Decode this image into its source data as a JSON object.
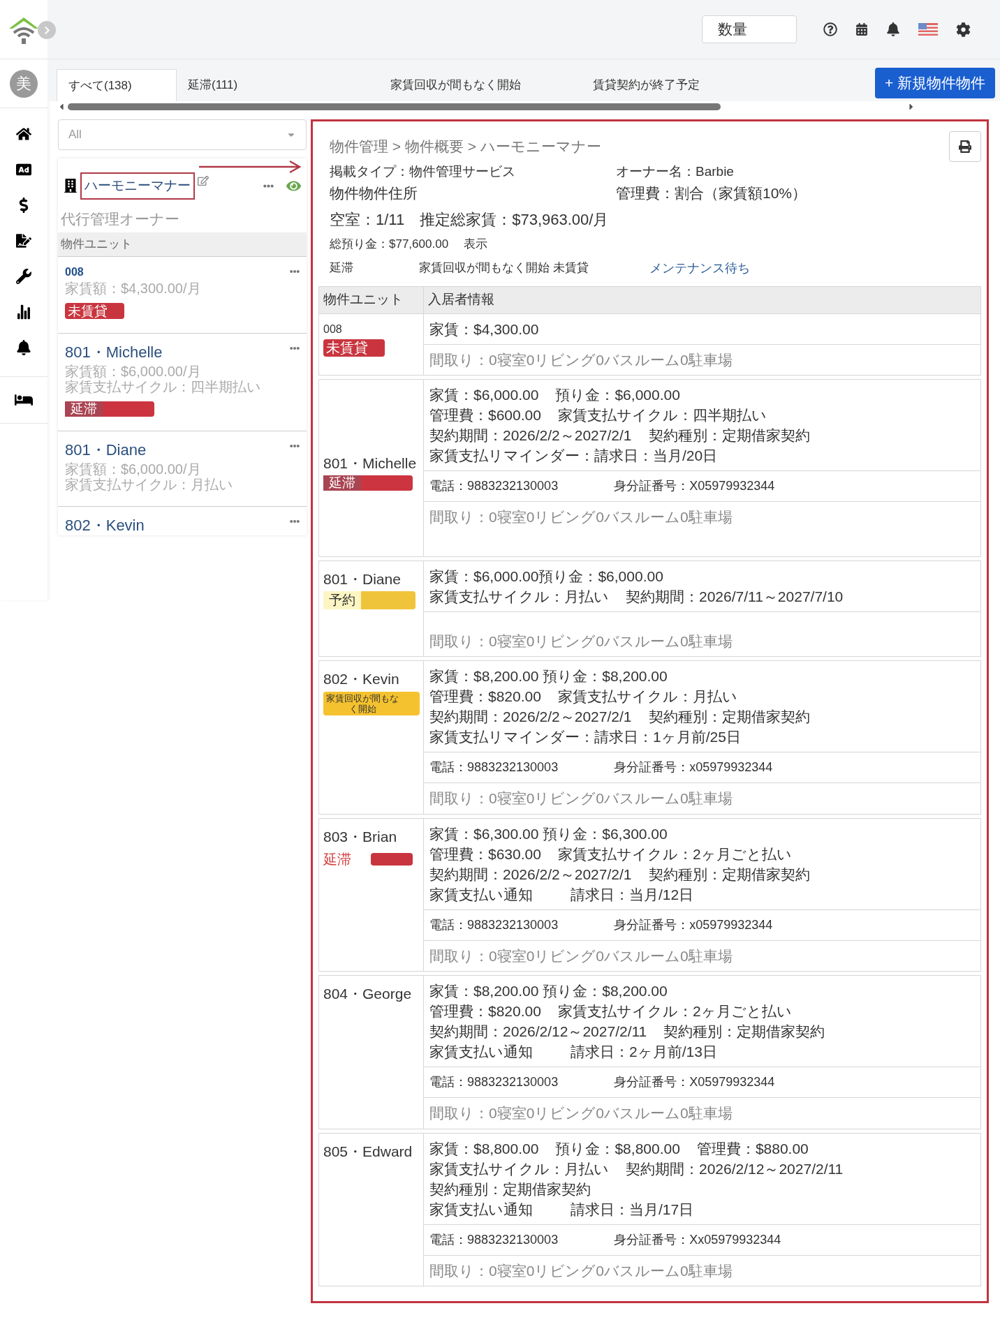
{
  "avatar": "美",
  "header": {
    "select_value": "数量"
  },
  "tabs": [
    {
      "label": "すべて(138)",
      "selected": true
    },
    {
      "label": "延滞(111)",
      "selected": false
    },
    {
      "label": "家賃回収が間もなく開始",
      "selected": false
    },
    {
      "label": "賃貸契約が終了予定",
      "selected": false
    }
  ],
  "new_button": "+ 新規物件物件",
  "filter": {
    "value": "All"
  },
  "property": {
    "name": "ハーモニーマナー",
    "highlighted": true,
    "owner_type": "代行管理オーナー",
    "units_heading": "物件ユニット"
  },
  "side_units": [
    {
      "name": "008",
      "small": true,
      "lines": [
        "家賃額：$4,300.00/月"
      ],
      "tag": {
        "label": "未賃貸",
        "kind": "vacant"
      }
    },
    {
      "name": "801・Michelle",
      "small": false,
      "lines": [
        "家賃額：$6,000.00/月",
        "家賃支払サイクル：四半期払い"
      ],
      "tag": {
        "label": "延滞",
        "kind": "overdue"
      }
    },
    {
      "name": "801・Diane",
      "small": false,
      "lines": [
        "家賃額：$6,000.00/月",
        "家賃支払サイクル：月払い"
      ]
    },
    {
      "name": "802・Kevin",
      "small": false
    }
  ],
  "detail": {
    "breadcrumb": "物件管理 > 物件概要 > ハーモニーマナー",
    "info": [
      [
        "掲載タイプ：物件管理サービス",
        "オーナー名：Barbie"
      ],
      [
        "物件物件住所",
        "管理費：割合（家賃額10%）"
      ]
    ],
    "summary": "空室：1/11　推定総家賃：$73,963.00/月",
    "deposit": [
      "総預り金：$77,600.00",
      "表示"
    ],
    "statuses": [
      {
        "label": "延滞",
        "link": false
      },
      {
        "label": "家賃回収が間もなく開始 未賃貸",
        "link": false
      },
      {
        "label": "メンテナンス待ち",
        "link": true
      }
    ],
    "columns": [
      "物件ユニット",
      "入居者情報"
    ],
    "units": [
      {
        "name": "008",
        "tag": {
          "label": "未賃貸",
          "kind": "vacant"
        },
        "lines": [
          [
            "家賃：$4,300.00"
          ]
        ],
        "layout": "間取り：0寝室0リビング0バスルーム0駐車場"
      },
      {
        "name": "801・Michelle",
        "tag": {
          "label": "延滞",
          "kind": "overdue"
        },
        "lines": [
          [
            "家賃：$6,000.00",
            "預り金：$6,000.00"
          ],
          [
            "管理費：$600.00",
            "家賃支払サイクル：四半期払い"
          ],
          [
            "契約期間：2026/2/2～2027/2/1",
            "契約種別：定期借家契約"
          ],
          [
            "家賃支払リマインダー：請求日：当月/20日"
          ]
        ],
        "contact": [
          "電話：9883232130003",
          "身分証番号：X05979932344"
        ],
        "layout": "間取り：0寝室0リビング0バスルーム0駐車場"
      },
      {
        "name": "801・Diane",
        "tag": {
          "label": "予約",
          "kind": "reserved"
        },
        "lines": [
          [
            "家賃：$6,000.00預り金：$6,000.00"
          ],
          [
            "家賃支払サイクル：月払い",
            "契約期間：2026/7/11～2027/7/10"
          ]
        ],
        "layout": "間取り：0寝室0リビング0バスルーム0駐車場"
      },
      {
        "name": "802・Kevin",
        "tag": {
          "label": "家賃回収が間もなく開始",
          "kind": "collecting"
        },
        "lines": [
          [
            "家賃：$8,200.00 預り金：$8,200.00"
          ],
          [
            "管理費：$820.00",
            "家賃支払サイクル：月払い"
          ],
          [
            "契約期間：2026/2/2～2027/2/1",
            "契約種別：定期借家契約"
          ],
          [
            "家賃支払リマインダー：請求日：1ヶ月前/25日"
          ]
        ],
        "contact": [
          "電話：9883232130003",
          "身分証番号：x05979932344"
        ],
        "layout": "間取り：0寝室0リビング0バスルーム0駐車場"
      },
      {
        "name": "803・Brian",
        "tag": {
          "label": "延滞",
          "kind": "overdue_text"
        },
        "lines": [
          [
            "家賃：$6,300.00 預り金：$6,300.00"
          ],
          [
            "管理費：$630.00",
            "家賃支払サイクル：2ヶ月ごと払い"
          ],
          [
            "契約期間：2026/2/2～2027/2/1",
            "契約種別：定期借家契約"
          ],
          [
            "家賃支払い通知",
            "請求日：当月/12日"
          ]
        ],
        "contact": [
          "電話：9883232130003",
          "身分証番号：x05979932344"
        ],
        "layout": "間取り：0寝室0リビング0バスルーム0駐車場"
      },
      {
        "name": "804・George",
        "lines": [
          [
            "家賃：$8,200.00 預り金：$8,200.00"
          ],
          [
            "管理費：$820.00",
            "家賃支払サイクル：2ヶ月ごと払い"
          ],
          [
            "契約期間：2026/2/12～2027/2/11",
            "契約種別：定期借家契約"
          ],
          [
            "家賃支払い通知",
            "請求日：2ヶ月前/13日"
          ]
        ],
        "contact": [
          "電話：9883232130003",
          "身分証番号：X05979932344"
        ],
        "layout": "間取り：0寝室0リビング0バスルーム0駐車場"
      },
      {
        "name": "805・Edward",
        "lines": [
          [
            "家賃：$8,800.00",
            "預り金：$8,800.00",
            "管理費：$880.00"
          ],
          [
            "家賃支払サイクル：月払い",
            "契約期間：2026/2/12～2027/2/11"
          ],
          [
            "契約種別：定期借家契約"
          ],
          [
            "家賃支払い通知",
            "請求日：当月/17日"
          ]
        ],
        "contact": [
          "電話：9883232130003",
          "身分証番号：Xx05979932344"
        ],
        "layout": "間取り：0寝室0リビング0バスルーム0駐車場"
      }
    ]
  }
}
